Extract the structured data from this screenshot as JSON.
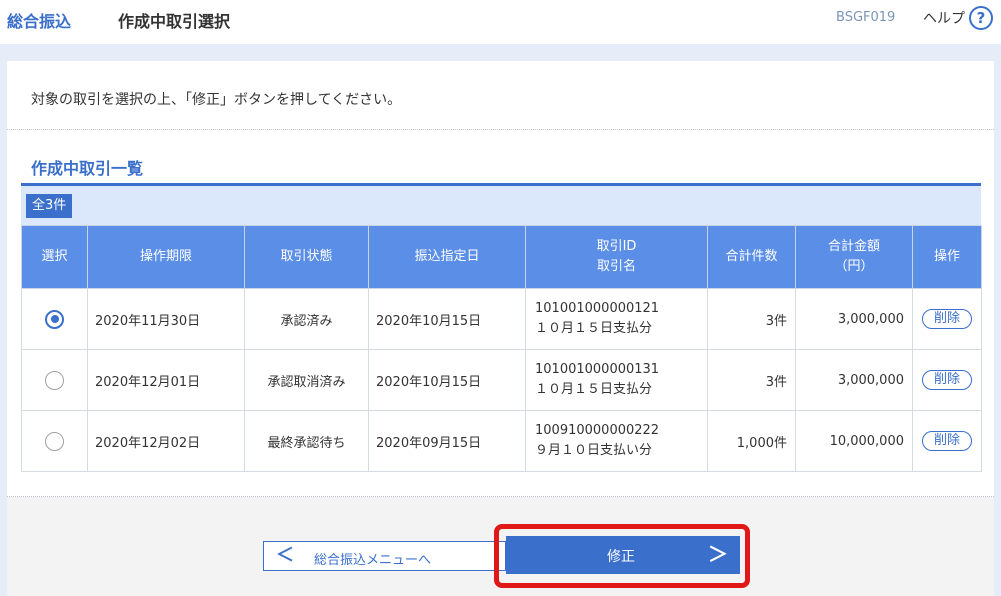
{
  "header": {
    "brand": "総合振込",
    "title": "作成中取引選択",
    "screen_id": "BSGF019",
    "help_label": "ヘルプ",
    "help_icon_glyph": "?"
  },
  "instruction": "対象の取引を選択の上、「修正」ボタンを押してください。",
  "section": {
    "title": "作成中取引一覧",
    "count_badge": "全3件"
  },
  "table": {
    "headers": {
      "select": "選択",
      "deadline": "操作期限",
      "status": "取引状態",
      "transfer_date": "振込指定日",
      "tx_id_line1": "取引ID",
      "tx_id_line2": "取引名",
      "total_count": "合計件数",
      "total_amount_line1": "合計金額",
      "total_amount_line2": "（円）",
      "action": "操作"
    },
    "rows": [
      {
        "selected": true,
        "deadline": "2020年11月30日",
        "status": "承認済み",
        "transfer_date": "2020年10月15日",
        "tx_id": "101001000000121",
        "tx_name": "１０月１５日支払分",
        "count": "3件",
        "amount": "3,000,000",
        "action": "削除"
      },
      {
        "selected": false,
        "deadline": "2020年12月01日",
        "status": "承認取消済み",
        "transfer_date": "2020年10月15日",
        "tx_id": "101001000000131",
        "tx_name": "１０月１５日支払分",
        "count": "3件",
        "amount": "3,000,000",
        "action": "削除"
      },
      {
        "selected": false,
        "deadline": "2020年12月02日",
        "status": "最終承認待ち",
        "transfer_date": "2020年09月15日",
        "tx_id": "100910000000222",
        "tx_name": "９月１０日支払い分",
        "count": "1,000件",
        "amount": "10,000,000",
        "action": "削除"
      }
    ]
  },
  "buttons": {
    "back_label": "総合振込メニューへ",
    "back_chevron": "＜",
    "submit_label": "修正",
    "submit_chevron": "＞"
  },
  "colors": {
    "accent": "#3a6fcb",
    "table_header": "#5b8ee6",
    "highlight": "#e01818"
  }
}
